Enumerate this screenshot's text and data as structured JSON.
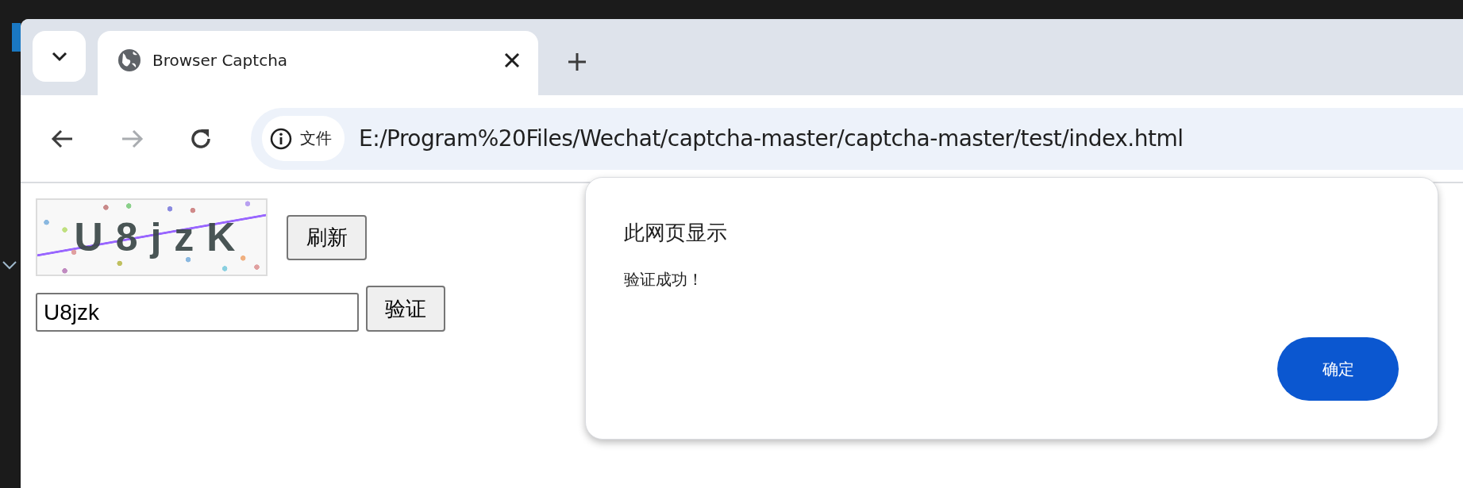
{
  "tab_strip": {
    "tabs": [
      {
        "title": "Browser Captcha",
        "selected": true
      }
    ]
  },
  "toolbar": {
    "nav_buttons": [
      {
        "kind": "back",
        "disabled": false
      },
      {
        "kind": "forward",
        "disabled": true
      },
      {
        "kind": "reload",
        "disabled": false
      }
    ],
    "omnibox": {
      "chip": "文件",
      "url": "E:/Program%20Files/Wechat/captcha-master/captcha-master/test/index.html"
    }
  },
  "page": {
    "captcha": {
      "text": "U8jzK"
    },
    "refresh_button": "刷新",
    "input": {
      "value": "U8jzk"
    },
    "verify_button": "验证"
  },
  "dialog": {
    "title": "此网页显示",
    "message": "验证成功！",
    "ok_button": "确定"
  }
}
